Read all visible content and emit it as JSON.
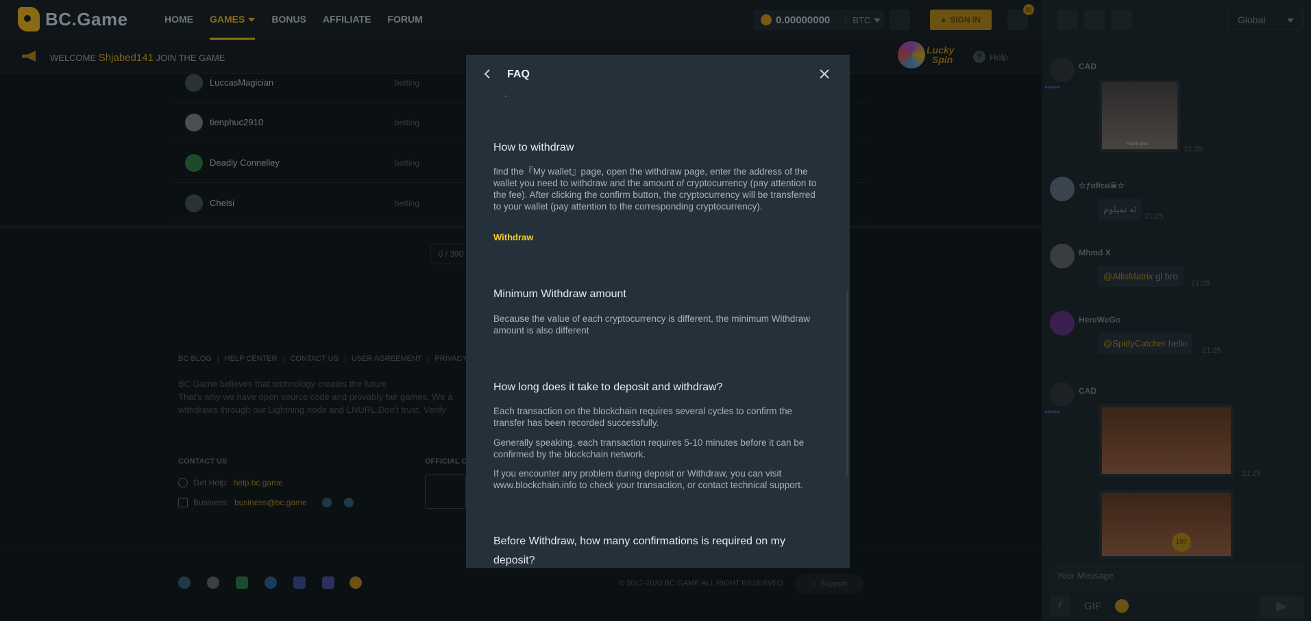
{
  "header": {
    "logo_text": "BC.Game",
    "nav": [
      "HOME",
      "GAMES",
      "BONUS",
      "AFFILIATE",
      "FORUM"
    ],
    "wallet_amount": "0.00000000",
    "wallet_currency": "BTC",
    "signin_label": "SIGN IN",
    "notif_count": "99"
  },
  "subbar": {
    "welcome_prefix": "WELCOME",
    "username": "Shjabed141",
    "welcome_suffix": "JOIN THE GAME",
    "lucky_line1": "Lucky",
    "lucky_line2": "Spin",
    "help_label": "Help"
  },
  "table": {
    "rows": [
      {
        "name": "LuccasMagician",
        "status": "betting"
      },
      {
        "name": "tienphuc2910",
        "status": "betting"
      },
      {
        "name": "Deadly Connelley",
        "status": "betting"
      },
      {
        "name": "Chelsi",
        "status": "betting"
      }
    ],
    "pager": "0 / 390"
  },
  "footer": {
    "links": [
      "BC BLOG",
      "HELP CENTER",
      "CONTACT US",
      "USER AGREEMENT",
      "PRIVACY"
    ],
    "blurb_1": "BC.Game believes that technology creates the future",
    "blurb_2": "That's why we have open source code and provably fair games. We a",
    "blurb_3": "withdraws through our Lightning node and LNURL.Don't trust. Verify",
    "contact_heading": "CONTACT US",
    "official_heading": "OFFICIAL C",
    "get_help_label": "Get Help:",
    "get_help_value": "help.bc.game",
    "business_label": "Business:",
    "business_value": "business@bc.game",
    "copyright": "© 2017-2020 BC.GAME ALL RIGHT RESERVED",
    "support_label": "Support"
  },
  "chat": {
    "room": "Global",
    "messages": [
      {
        "name": "CAD",
        "time": "21:25",
        "image_caption": "Thank you."
      },
      {
        "name": "☆ƒαłłєи☠☆",
        "text": "ئه تميلوم",
        "time": "21:25"
      },
      {
        "name": "Mhmd X",
        "mention": "@AllisMatrix",
        "text": "gl bro",
        "time": "21:25"
      },
      {
        "name": "HereWeGo",
        "mention": "@SpidyCatcher",
        "text": "hello",
        "time": "21:25"
      },
      {
        "name": "CAD",
        "time": "21:25",
        "badge": "107"
      }
    ],
    "input_placeholder": "Your Message",
    "slash": "/",
    "gif": "GIF"
  },
  "modal": {
    "title": "FAQ",
    "fragment": ".",
    "sections": [
      {
        "heading": "How to withdraw",
        "paragraphs": [
          "find the『My wallet』page, open the withdraw page, enter the address of the wallet you need to withdraw and the amount of cryptocurrency (pay attention to the fee). After clicking the confirm button, the cryptocurrency will be transferred to your wallet (pay attention to the corresponding cryptocurrency)."
        ],
        "link": "Withdraw"
      },
      {
        "heading": "Minimum Withdraw amount",
        "paragraphs": [
          "Because the value of each cryptocurrency is different, the minimum Withdraw amount is also different"
        ]
      },
      {
        "heading": "How long does it take to deposit and withdraw?",
        "paragraphs": [
          "Each transaction on the blockchain requires several cycles to confirm the transfer has been recorded successfully.",
          "Generally speaking, each transaction requires 5-10 minutes before it can be confirmed by the blockchain network.",
          "If you encounter any problem during deposit or Withdraw, you can visit www.blockchain.info to check your transaction, or contact technical support."
        ]
      },
      {
        "heading": "Before Withdraw, how many confirmations is required on my deposit?"
      }
    ]
  },
  "colors": {
    "accent": "#f2cd2f",
    "modal_bg": "#24313a",
    "page_bg": "#0b1013"
  }
}
